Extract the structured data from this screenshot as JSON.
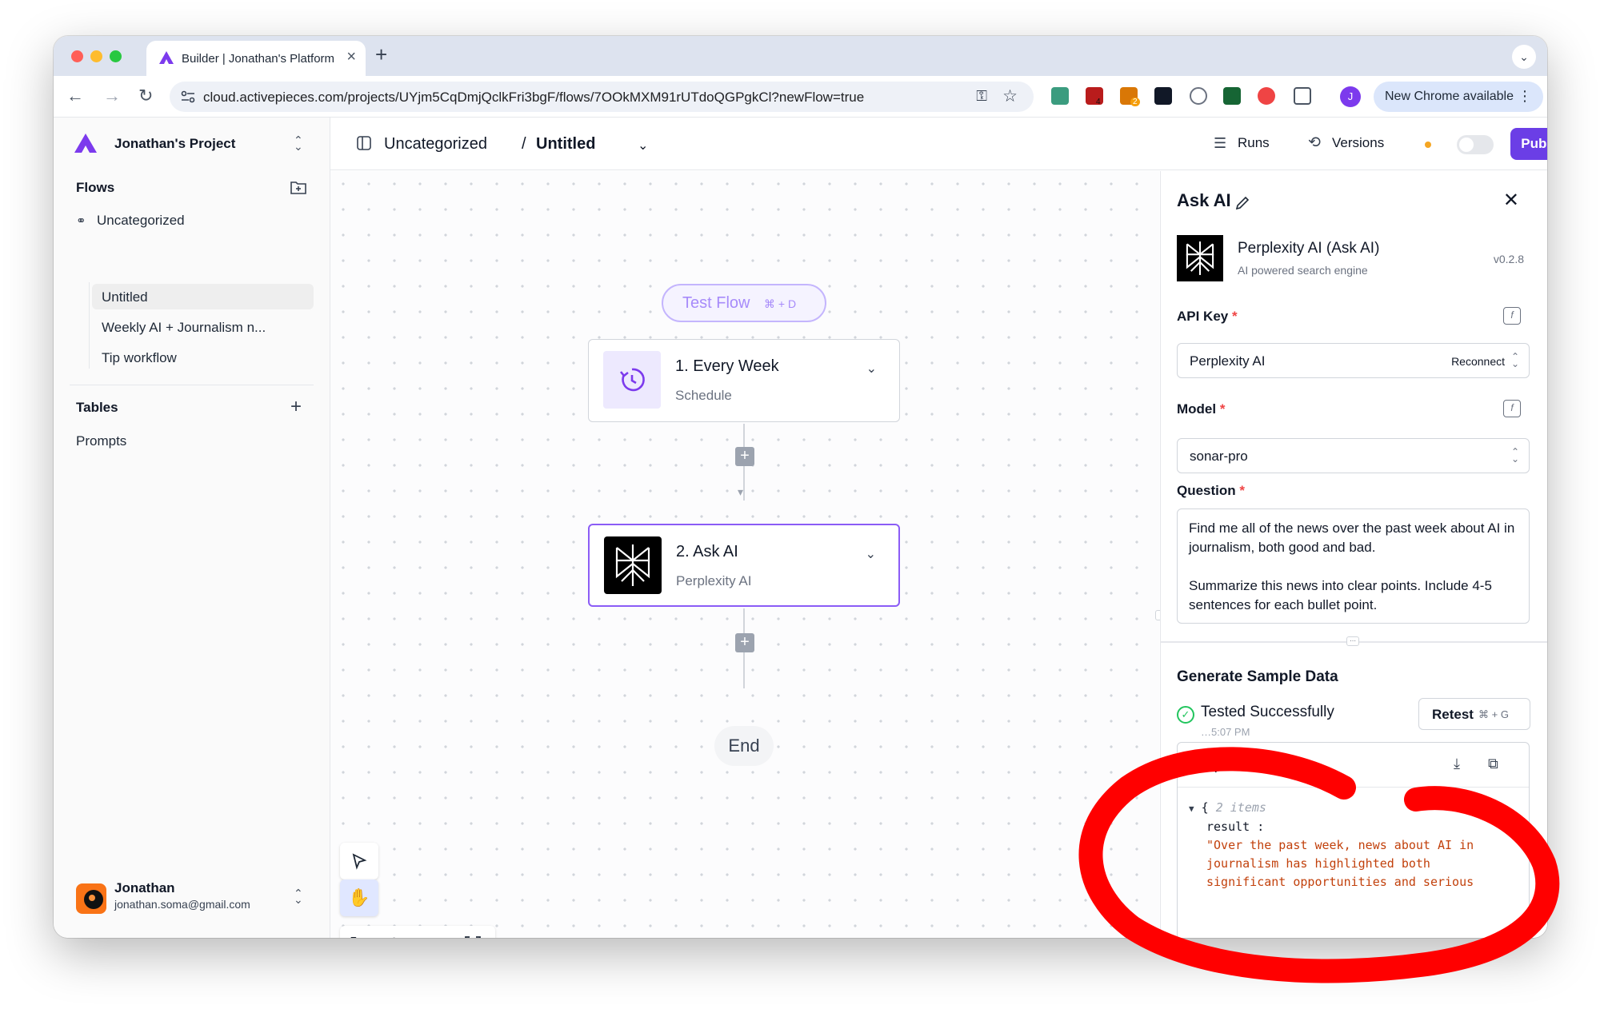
{
  "browser": {
    "tab_title": "Builder | Jonathan's Platform",
    "url": "cloud.activepieces.com/projects/UYjm5CqDmjQclkFri3bgF/flows/7OOkMXM91rUTdoQGPgkCl?newFlow=true",
    "profile_initial": "J",
    "update_label": "New Chrome available",
    "extension_badges": [
      "4",
      "2"
    ]
  },
  "sidebar": {
    "project_name": "Jonathan's Project",
    "flows_title": "Flows",
    "folder": "Uncategorized",
    "flows": [
      "Untitled",
      "Weekly AI + Journalism n...",
      "Tip workflow"
    ],
    "tables_title": "Tables",
    "tables": [
      "Prompts"
    ],
    "user": {
      "name": "Jonathan",
      "email": "jonathan.soma@gmail.com"
    }
  },
  "topbar": {
    "folder": "Uncategorized",
    "separator": "/",
    "flow_name": "Untitled",
    "runs_label": "Runs",
    "versions_label": "Versions",
    "publish_label": "Publish"
  },
  "canvas": {
    "test_flow_label": "Test Flow",
    "test_flow_shortcut": "⌘ + D",
    "steps": [
      {
        "title": "1. Every Week",
        "subtitle": "Schedule"
      },
      {
        "title": "2. Ask AI",
        "subtitle": "Perplexity AI"
      }
    ],
    "end_label": "End"
  },
  "panel": {
    "title": "Ask AI",
    "piece_name": "Perplexity AI (Ask AI)",
    "piece_desc": "AI powered search engine",
    "version": "v0.2.8",
    "api_key_label": "API Key",
    "api_key_value": "Perplexity AI",
    "reconnect_label": "Reconnect",
    "model_label": "Model",
    "model_value": "sonar-pro",
    "question_label": "Question",
    "question_p1": "Find me all of the news over the past week about AI in journalism, both good and bad.",
    "question_p2": "Summarize this news into clear points. Include 4-5 sentences for each bullet point.",
    "sample_title": "Generate Sample Data",
    "tested_label": "Tested Successfully",
    "tested_time": "…5:07 PM",
    "retest_label": "Retest",
    "retest_shortcut": "⌘ + G",
    "output_title": "Output",
    "json_brace": "{",
    "json_count": "2 items",
    "json_key": "result :",
    "json_line1": "\"Over the past week, news about AI in",
    "json_line2": "journalism has highlighted both",
    "json_line3": "significant opportunities and serious"
  },
  "colors": {
    "accent": "#6b3ee6",
    "annotation": "#ff0000",
    "success": "#22c55e",
    "json_string": "#c2410c"
  }
}
